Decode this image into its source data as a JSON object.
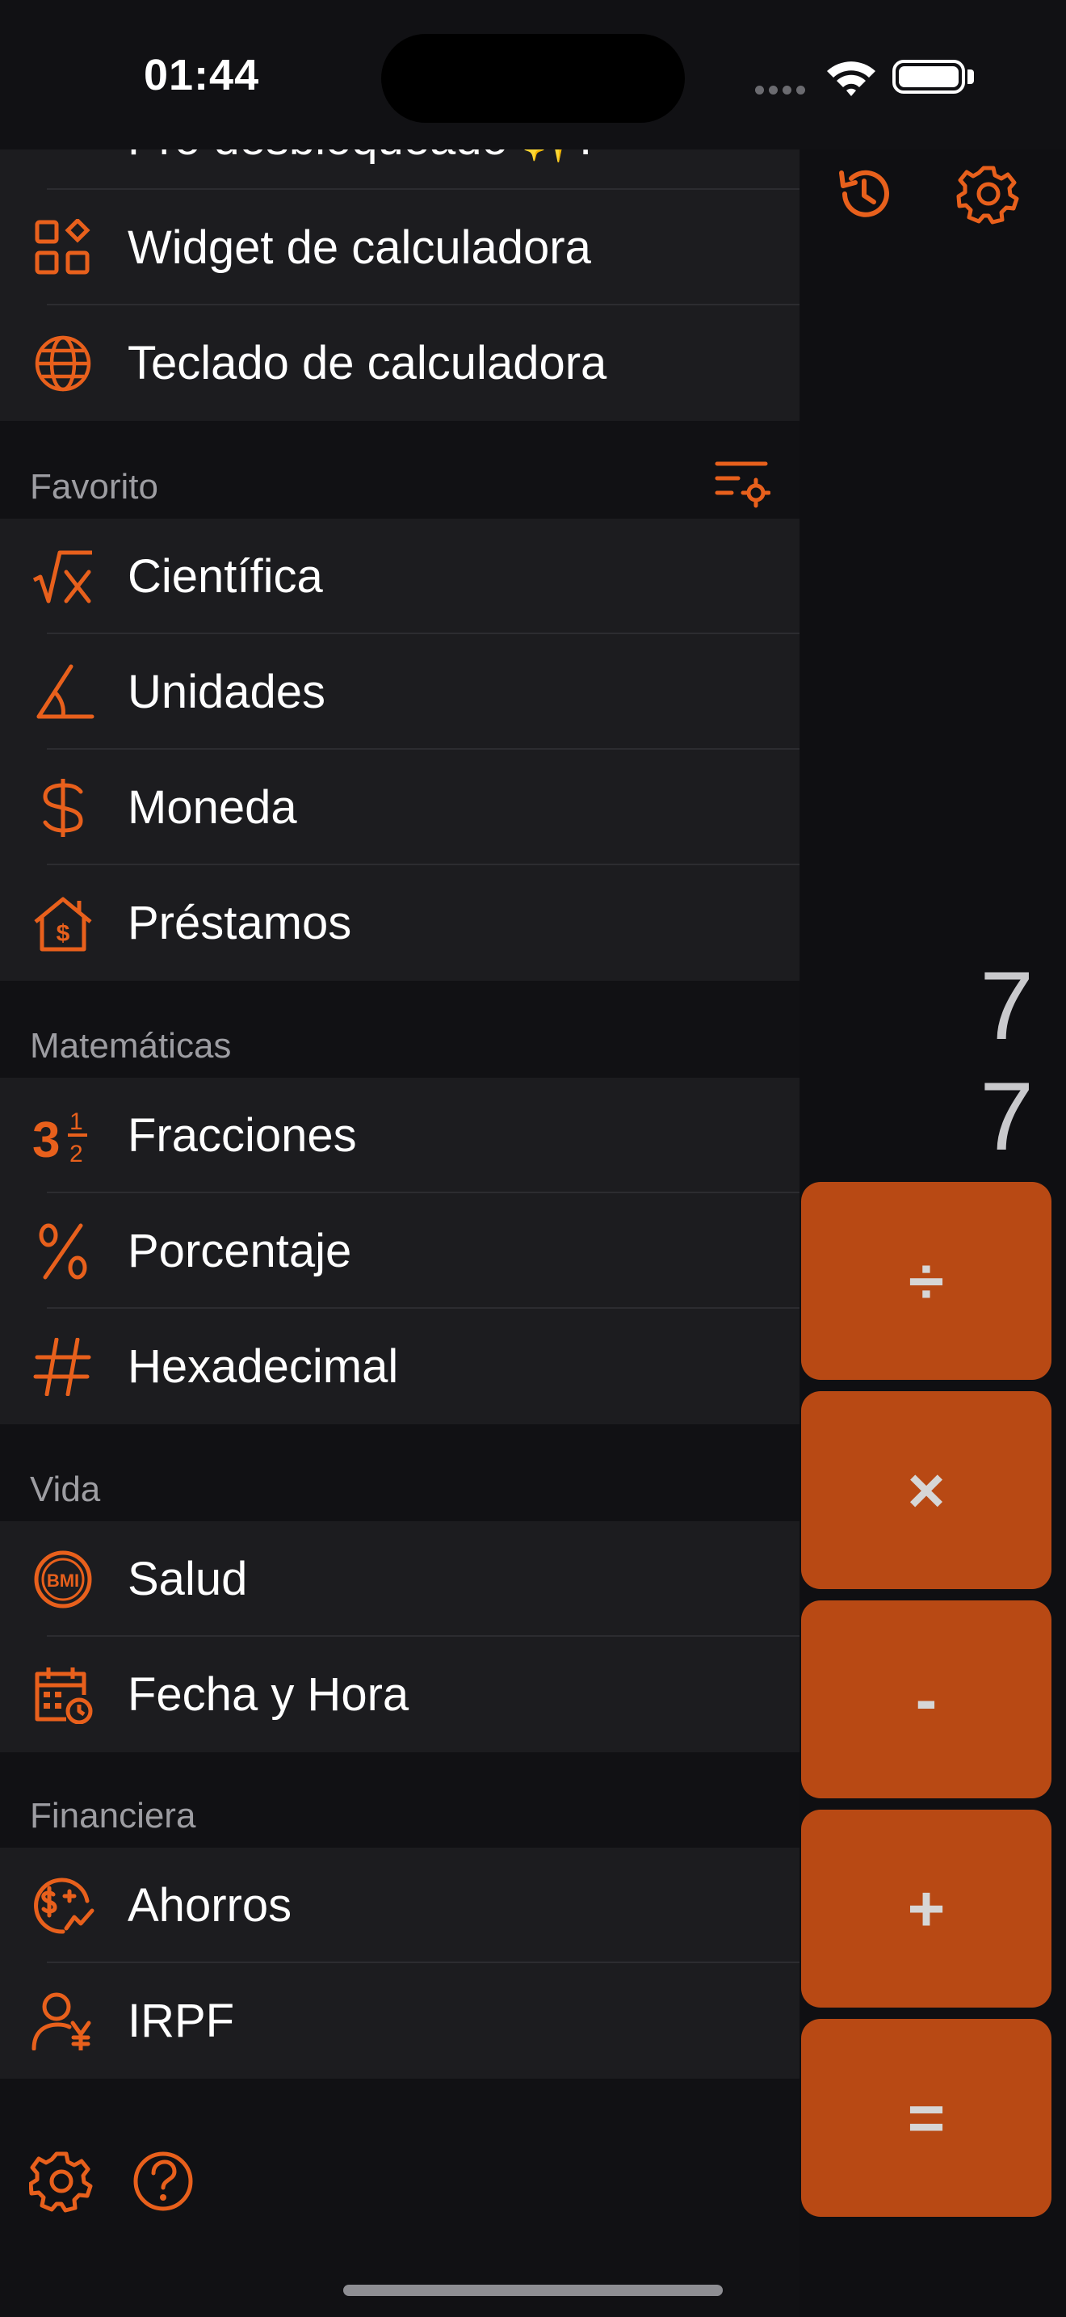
{
  "status_bar": {
    "time": "01:44"
  },
  "drawer": {
    "partial_item_label": "Pro desbloqueado ✨!",
    "top_items": [
      {
        "label": "Widget de calculadora",
        "icon": "widget-grid-icon"
      },
      {
        "label": "Teclado de calculadora",
        "icon": "globe-icon"
      }
    ],
    "sections": [
      {
        "title": "Favorito",
        "header_icon": "list-settings-icon",
        "items": [
          {
            "label": "Científica",
            "icon": "square-root-icon"
          },
          {
            "label": "Unidades",
            "icon": "angle-ruler-icon"
          },
          {
            "label": "Moneda",
            "icon": "dollar-icon"
          },
          {
            "label": "Préstamos",
            "icon": "house-dollar-icon"
          }
        ]
      },
      {
        "title": "Matemáticas",
        "items": [
          {
            "label": "Fracciones",
            "icon": "fraction-icon"
          },
          {
            "label": "Porcentaje",
            "icon": "percent-icon"
          },
          {
            "label": "Hexadecimal",
            "icon": "hash-icon"
          }
        ]
      },
      {
        "title": "Vida",
        "items": [
          {
            "label": "Salud",
            "icon": "bmi-icon",
            "icon_text": "BMI"
          },
          {
            "label": "Fecha y Hora",
            "icon": "calendar-clock-icon"
          }
        ]
      },
      {
        "title": "Financiera",
        "items": [
          {
            "label": "Ahorros",
            "icon": "savings-chart-icon"
          },
          {
            "label": "IRPF",
            "icon": "person-yen-icon"
          }
        ]
      }
    ],
    "footer_icons": [
      "gear-icon",
      "help-icon"
    ]
  },
  "calculator": {
    "display_expression": "7",
    "display_result": "7",
    "operators": [
      "÷",
      "×",
      "-",
      "+",
      "="
    ]
  },
  "colors": {
    "accent": "#e8601c",
    "operator_button": "#b84914",
    "row_background": "#1c1c1f",
    "drawer_background": "#111114"
  }
}
